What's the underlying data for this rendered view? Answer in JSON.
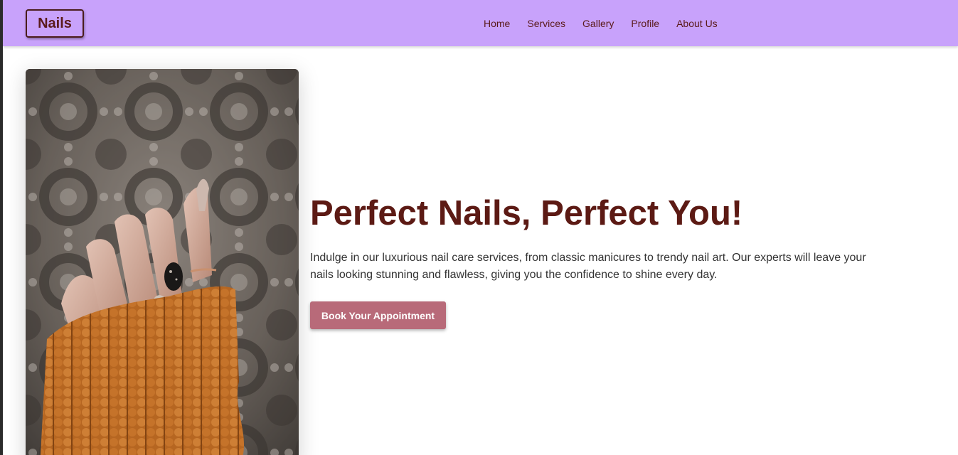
{
  "header": {
    "logo": "Nails",
    "nav": [
      {
        "label": "Home"
      },
      {
        "label": "Services"
      },
      {
        "label": "Gallery"
      },
      {
        "label": "Profile"
      },
      {
        "label": "About Us"
      }
    ]
  },
  "hero": {
    "image_icon": "hand-with-painted-nails-photo",
    "title": "Perfect Nails, Perfect You!",
    "description": "Indulge in our luxurious nail care services, from classic manicures to trendy nail art. Our experts will leave your nails looking stunning and flawless, giving you the confidence to shine every day.",
    "cta_label": "Book Your Appointment"
  },
  "colors": {
    "navbar_bg": "#c8a2fb",
    "title_color": "#5c1a14",
    "button_bg": "#b86a79"
  }
}
